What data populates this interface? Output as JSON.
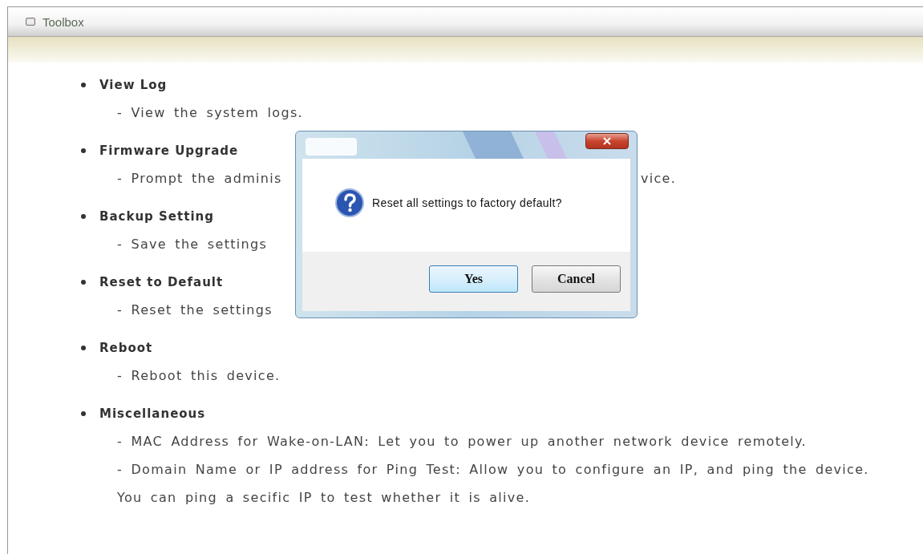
{
  "panel": {
    "title": "Toolbox"
  },
  "items": [
    {
      "title": "View Log",
      "lines": [
        {
          "text": "- View the system logs."
        }
      ]
    },
    {
      "title": "Firmware Upgrade",
      "lines": [
        {
          "text": "- Prompt the adminis",
          "tail": "vice."
        }
      ]
    },
    {
      "title": "Backup Setting",
      "lines": [
        {
          "text": "- Save the settings"
        }
      ]
    },
    {
      "title": "Reset to Default",
      "lines": [
        {
          "text": "- Reset the settings"
        }
      ]
    },
    {
      "title": "Reboot",
      "lines": [
        {
          "text": "- Reboot this device."
        }
      ]
    },
    {
      "title": "Miscellaneous",
      "lines": [
        {
          "text": "- MAC Address for Wake-on-LAN: Let you to power up another network device remotely."
        },
        {
          "text": "- Domain Name or IP address for Ping Test: Allow you to configure an IP, and ping the device. You can ping a secific IP to test whether it is alive."
        }
      ]
    }
  ],
  "dialog": {
    "message": "Reset all settings to factory default?",
    "buttons": [
      {
        "label": "Yes",
        "focused": true
      },
      {
        "label": "Cancel",
        "focused": false
      }
    ]
  }
}
